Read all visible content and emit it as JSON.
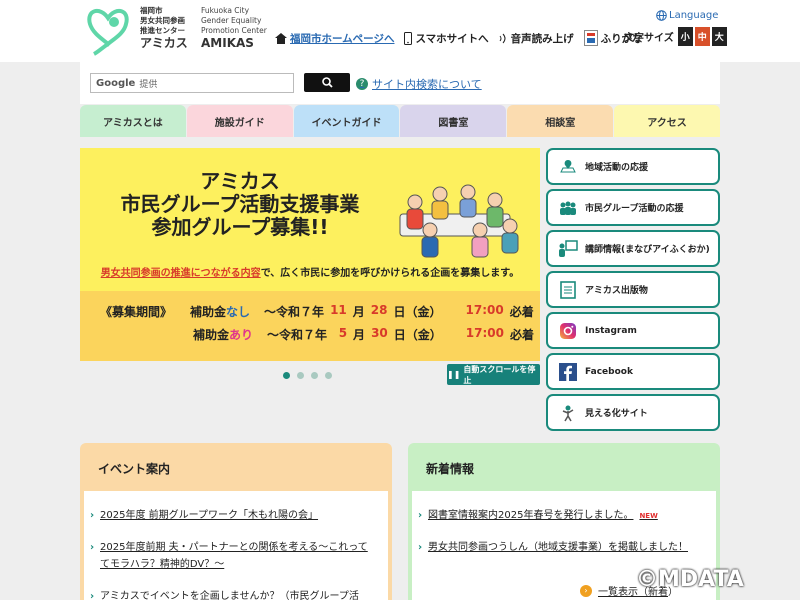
{
  "header": {
    "logo_jp_lines": [
      "福岡市",
      "男女共同参画",
      "推進センター"
    ],
    "logo_jp_name": "アミカス",
    "logo_en_lines": [
      "Fukuoka City",
      "Gender Equality",
      "Promotion Center"
    ],
    "logo_en_name": "AMIKAS",
    "links": [
      "福岡市ホームページへ",
      "スマホサイトへ",
      "音声読み上げ",
      "ふりがな"
    ],
    "language": "Language",
    "fontsize_label": "文字サイズ",
    "fontsize_options": [
      "小",
      "中",
      "大"
    ]
  },
  "search": {
    "brand": "Google",
    "brand_suffix": "提供",
    "about": "サイト内検索について"
  },
  "nav": [
    "アミカスとは",
    "施設ガイド",
    "イベントガイド",
    "図書室",
    "相談室",
    "アクセス"
  ],
  "banner": {
    "title_lines": [
      "アミカス",
      "市民グループ活動支援事業",
      "参加グループ募集!!"
    ],
    "sub_red": "男女共同参画の推進につながる内容",
    "sub_rest": "で、広く市民に参加を呼びかけられる企画を募集します。",
    "period_label": "《募集期間》",
    "row1": {
      "a": "補助金",
      "b": "なし",
      "c": "～令和７年",
      "m": "11",
      "d1": "月",
      "d": "28",
      "d2": "日（金）",
      "t": "17:00",
      "e": "必着"
    },
    "row2": {
      "a": "補助金",
      "b": "あり",
      "c": "～令和７年",
      "m": "5",
      "d1": "月",
      "d": "30",
      "d2": "日（金）",
      "t": "17:00",
      "e": "必着"
    }
  },
  "carousel": {
    "stop_label": "自動スクロールを停止"
  },
  "side": [
    "地域活動の応援",
    "市民グループ活動の応援",
    "講師情報(まなびアイふくおか)",
    "アミカス出版物",
    "Instagram",
    "Facebook",
    "見える化サイト"
  ],
  "events": {
    "title": "イベント案内",
    "items": [
      "2025年度 前期グループワーク「木もれ陽の会」",
      "2025年度前期 夫・パートナーとの関係を考える～これって",
      "てモラハラ？精神的DV？～",
      "アミカスでイベントを企画しませんか？（市民グループ活"
    ]
  },
  "news": {
    "title": "新着情報",
    "items": [
      "図書室情報案内2025年春号を発行しました。",
      "男女共同参画つうしん（地域支援事業）を掲載しました！"
    ],
    "new_badge": "NEW",
    "more": "一覧表示（新着",
    "more_suffix": "）"
  },
  "watermark": "©MDATA",
  "colors": {
    "accent": "#1a8a7c",
    "banner_yellow": "#fdf05e",
    "banner_orange": "#fbd45c",
    "nav": [
      "#c6eed0",
      "#fbd6dc",
      "#bde0f8",
      "#d9d4ec",
      "#fbdcb0",
      "#fdf8b0"
    ]
  }
}
